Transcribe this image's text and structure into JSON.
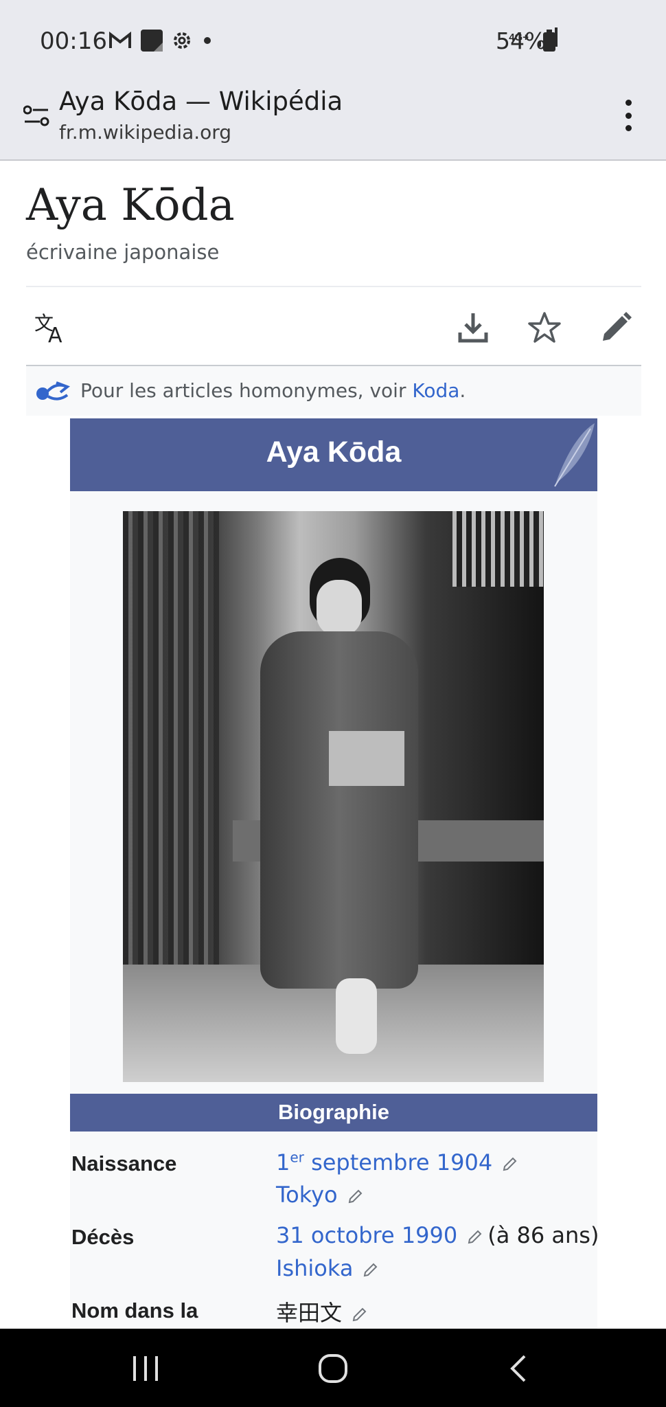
{
  "status_bar": {
    "time": "00:16",
    "network": "4G+",
    "battery": "54%"
  },
  "browser": {
    "title": "Aya Kōda — Wikipédia",
    "url": "fr.m.wikipedia.org"
  },
  "article": {
    "title": "Aya Kōda",
    "description": "écrivaine japonaise",
    "hatnote_prefix": "Pour les articles homonymes, voir ",
    "hatnote_link": "Koda",
    "hatnote_suffix": "."
  },
  "infobox": {
    "title": "Aya Kōda",
    "section": "Biographie",
    "rows": [
      {
        "label": "Naissance",
        "value1_pre": "1",
        "value1_sup": "er",
        "value1_link": " septembre 1904",
        "value2_link": "Tokyo"
      },
      {
        "label": "Décès",
        "value1_link": "31 octobre 1990",
        "value1_extra": "(à 86 ans)",
        "value2_link": "Ishioka"
      },
      {
        "label": "Nom dans la",
        "value1": "幸田文"
      }
    ]
  }
}
